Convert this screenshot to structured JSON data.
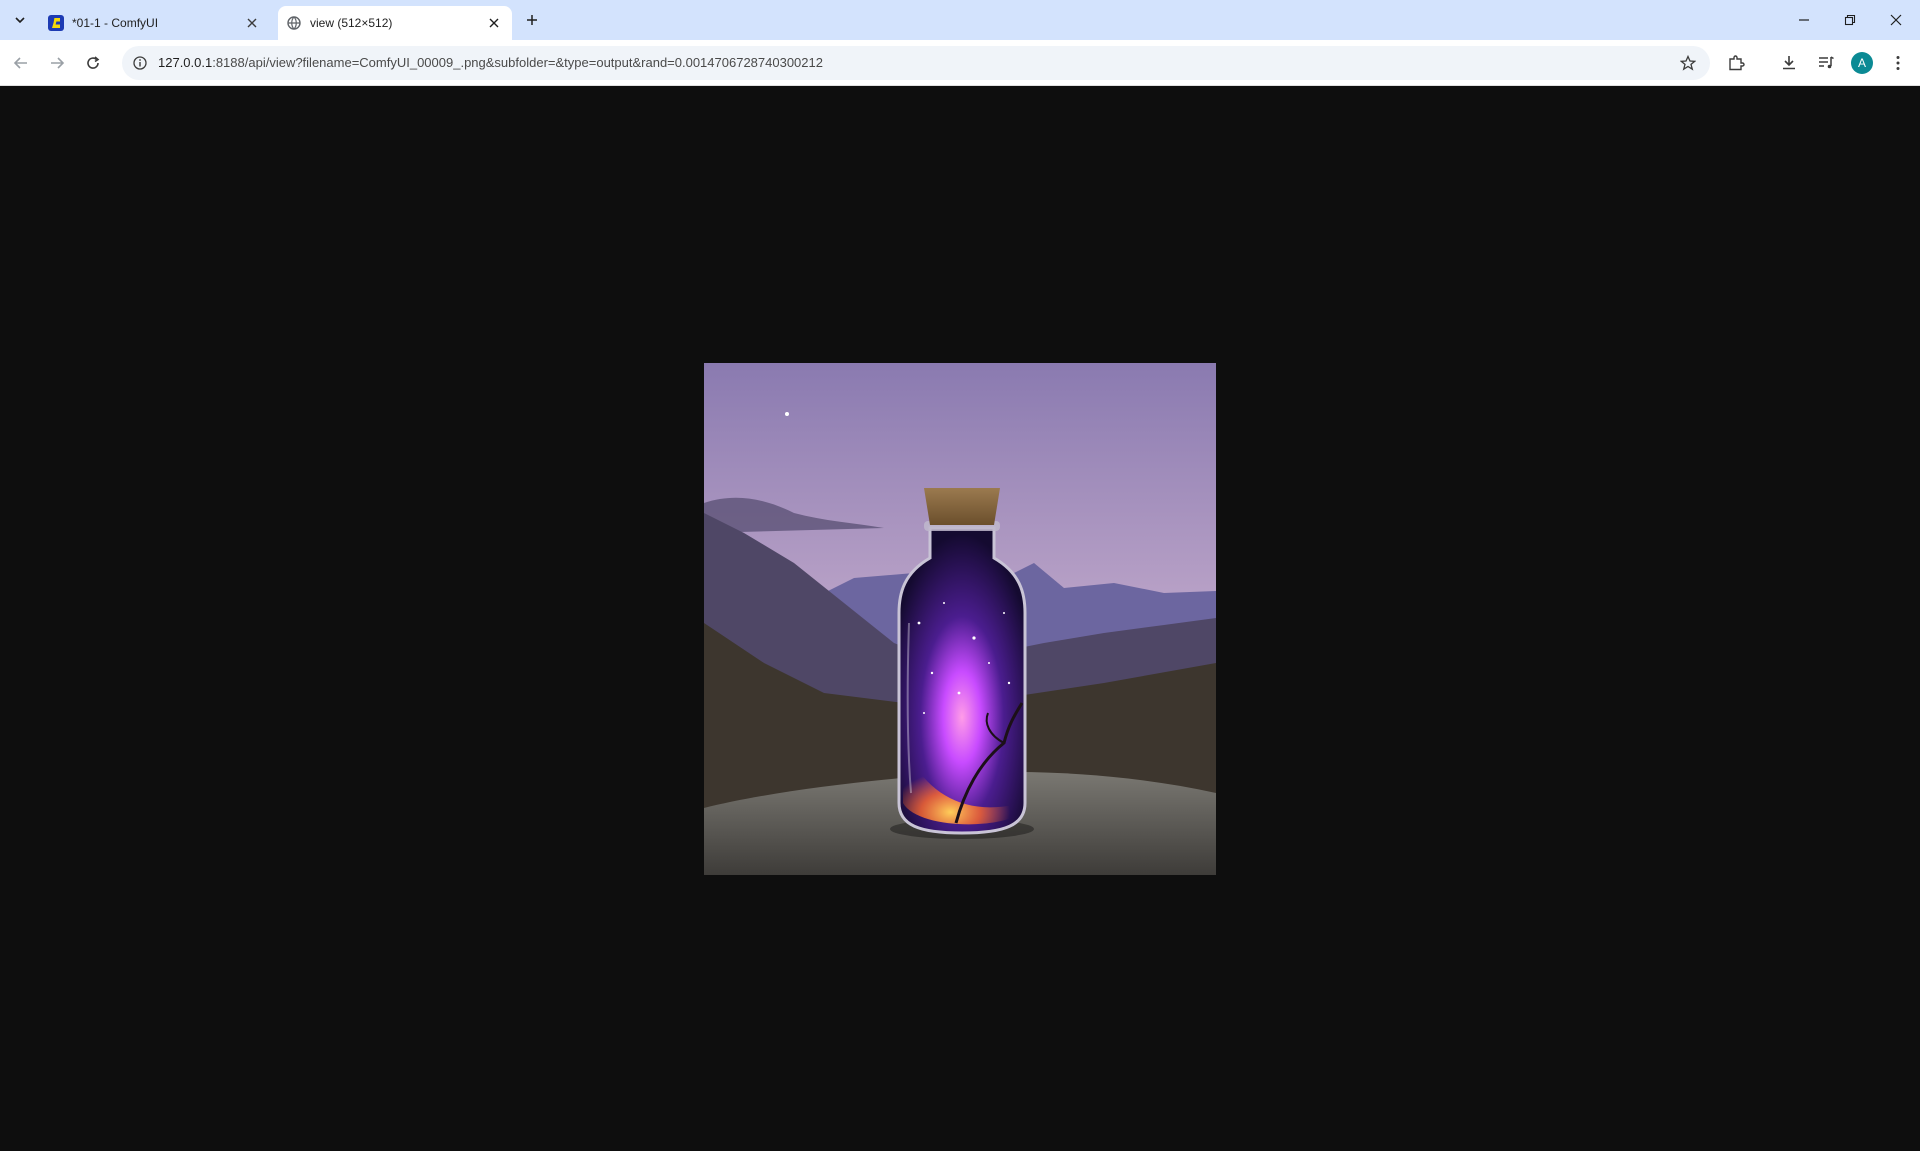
{
  "browser": {
    "tabs": [
      {
        "title": "*01-1 - ComfyUI",
        "active": false,
        "favicon": "comfyui-icon"
      },
      {
        "title": "view (512×512)",
        "active": true,
        "favicon": "globe-icon"
      }
    ],
    "address_bar": {
      "host": "127.0.0.1",
      "rest": ":8188/api/view?filename=ComfyUI_00009_.png&subfolder=&type=output&rand=0.0014706728740300212"
    },
    "profile_initial": "A"
  },
  "colors": {
    "tabstrip": "#d3e3fd",
    "page_background": "#0e0e0e",
    "avatar": "#0b8a94"
  },
  "image": {
    "description_icon": "glass-bottle-galaxy-image",
    "width": 512,
    "height": 512
  }
}
